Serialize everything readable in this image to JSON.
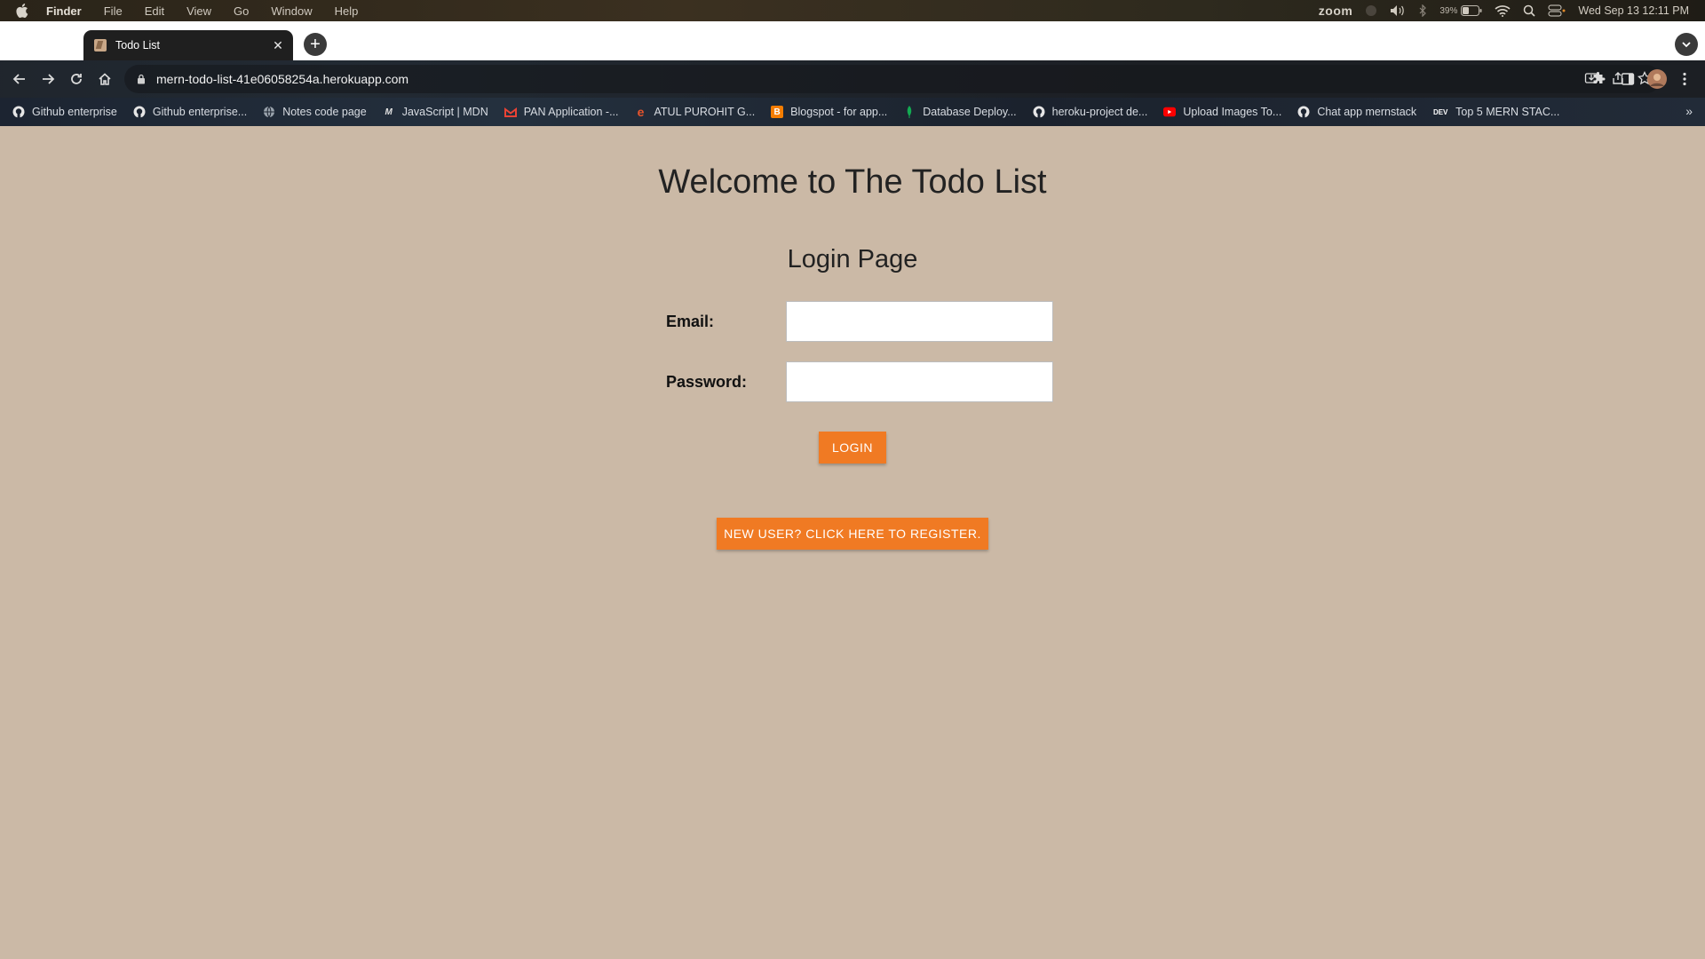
{
  "menubar": {
    "app_name": "Finder",
    "items": [
      "File",
      "Edit",
      "View",
      "Go",
      "Window",
      "Help"
    ],
    "zoom_label": "zoom",
    "battery": "39%",
    "clock": "Wed Sep 13  12:11 PM"
  },
  "browser": {
    "tab_title": "Todo List",
    "new_tab_symbol": "+",
    "url": "mern-todo-list-41e06058254a.herokuapp.com",
    "bookmarks": [
      {
        "label": "Github enterprise",
        "icon": "github-icon"
      },
      {
        "label": "Github enterprise...",
        "icon": "github-icon"
      },
      {
        "label": "Notes code page",
        "icon": "globe-icon"
      },
      {
        "label": "JavaScript | MDN",
        "icon": "mdn-icon"
      },
      {
        "label": "PAN Application -...",
        "icon": "gmail-icon"
      },
      {
        "label": "ATUL PUROHIT G...",
        "icon": "edge-icon"
      },
      {
        "label": "Blogspot - for app...",
        "icon": "blogger-icon"
      },
      {
        "label": "Database Deploy...",
        "icon": "mongodb-icon"
      },
      {
        "label": "heroku-project de...",
        "icon": "github-icon"
      },
      {
        "label": "Upload Images To...",
        "icon": "youtube-icon"
      },
      {
        "label": "Chat app mernstack",
        "icon": "github-icon"
      },
      {
        "label": "Top 5 MERN STAC...",
        "icon": "dev-icon"
      }
    ],
    "dev_badge": "DEV",
    "more_bookmarks": "»"
  },
  "page": {
    "heading": "Welcome to The Todo List",
    "subheading": "Login Page",
    "email_label": "Email:",
    "email_value": "",
    "password_label": "Password:",
    "password_value": "",
    "login_button": "LOGIN",
    "register_button": "NEW USER? CLICK HERE TO REGISTER."
  },
  "colors": {
    "page_background": "#cbb9a6",
    "button_orange": "#f07a23"
  }
}
